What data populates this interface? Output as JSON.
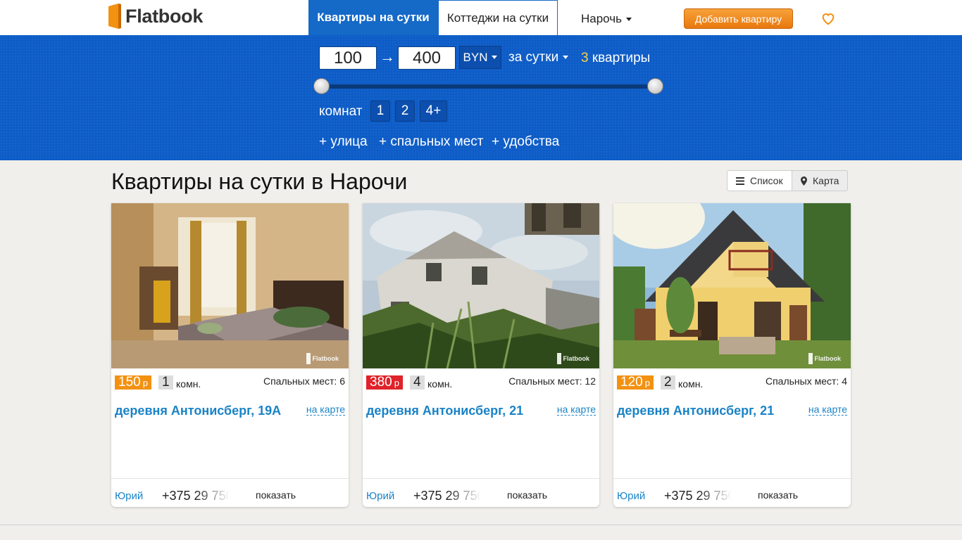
{
  "header": {
    "logo_text": "Flatbook",
    "tabs": [
      {
        "label": "Квартиры на сутки",
        "active": true
      },
      {
        "label": "Коттеджи на сутки",
        "active": false
      }
    ],
    "city": "Нарочь",
    "add_button": "Добавить квартиру",
    "favorites_icon": "heart-icon",
    "colors": {
      "brand_blue": "#1569c7",
      "accent_orange": "#f39111"
    }
  },
  "filters": {
    "price_min": "100",
    "price_max": "400",
    "arrow": "→",
    "currency": "BYN",
    "period": "за сутки",
    "result_count": "3",
    "result_label": "квартиры",
    "price_slider": {
      "min": 100,
      "max": 400,
      "low": 100,
      "high": 400
    },
    "rooms_label": "комнат",
    "rooms_options": [
      "1",
      "2",
      "4+"
    ],
    "extras": [
      "+ улица",
      "+ спальных мест",
      "+ удобства"
    ]
  },
  "main": {
    "title": "Квартиры на сутки в Нарочи",
    "view_toggle": {
      "list": "Список",
      "map": "Карта"
    },
    "listings": [
      {
        "price": "150",
        "currency_symbol": "р",
        "price_color": "#f39111",
        "rooms": "1",
        "rooms_suffix": "комн.",
        "beds": "Спальных мест: 6",
        "address": "деревня Антонисберг, 19А",
        "map_link": "на карте",
        "owner": "Юрий",
        "phone": "+375 29 750",
        "show_label": "показать",
        "watermark": "Flatbook"
      },
      {
        "price": "380",
        "currency_symbol": "р",
        "price_color": "#e0222a",
        "rooms": "4",
        "rooms_suffix": "комн.",
        "beds": "Спальных мест: 12",
        "address": "деревня Антонисберг, 21",
        "map_link": "на карте",
        "owner": "Юрий",
        "phone": "+375 29 750",
        "show_label": "показать",
        "watermark": "Flatbook"
      },
      {
        "price": "120",
        "currency_symbol": "р",
        "price_color": "#f39111",
        "rooms": "2",
        "rooms_suffix": "комн.",
        "beds": "Спальных мест: 4",
        "address": "деревня Антонисберг, 21",
        "map_link": "на карте",
        "owner": "Юрий",
        "phone": "+375 29 750",
        "show_label": "показать",
        "watermark": "Flatbook"
      }
    ]
  }
}
